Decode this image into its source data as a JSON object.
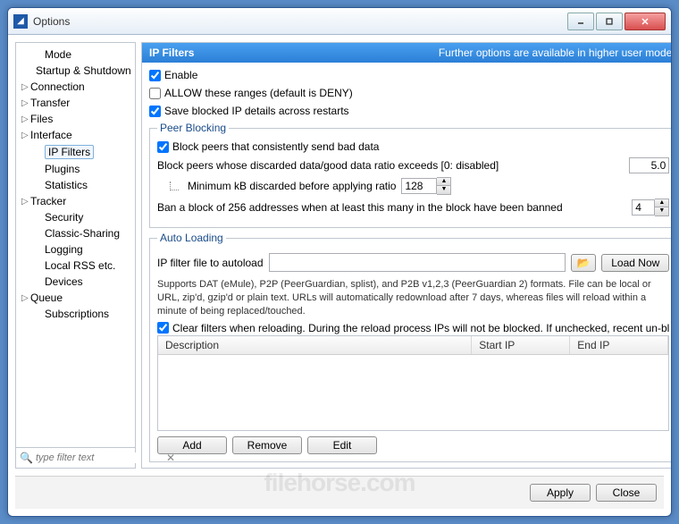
{
  "window": {
    "title": "Options"
  },
  "sidebar": {
    "items": [
      {
        "label": "Mode",
        "expandable": false,
        "indent": true
      },
      {
        "label": "Startup & Shutdown",
        "expandable": false,
        "indent": true
      },
      {
        "label": "Connection",
        "expandable": true
      },
      {
        "label": "Transfer",
        "expandable": true
      },
      {
        "label": "Files",
        "expandable": true
      },
      {
        "label": "Interface",
        "expandable": true
      },
      {
        "label": "IP Filters",
        "expandable": false,
        "indent": true,
        "selected": true
      },
      {
        "label": "Plugins",
        "expandable": false,
        "indent": true
      },
      {
        "label": "Statistics",
        "expandable": false,
        "indent": true
      },
      {
        "label": "Tracker",
        "expandable": true
      },
      {
        "label": "Security",
        "expandable": false,
        "indent": true
      },
      {
        "label": "Classic-Sharing",
        "expandable": false,
        "indent": true
      },
      {
        "label": "Logging",
        "expandable": false,
        "indent": true
      },
      {
        "label": "Local RSS etc.",
        "expandable": false,
        "indent": true
      },
      {
        "label": "Devices",
        "expandable": false,
        "indent": true
      },
      {
        "label": "Queue",
        "expandable": true
      },
      {
        "label": "Subscriptions",
        "expandable": false,
        "indent": true
      }
    ],
    "filter_placeholder": "type filter text"
  },
  "header": {
    "title": "IP Filters",
    "subtitle": "Further options are available in higher user modes"
  },
  "checks": {
    "enable": "Enable",
    "allow": "ALLOW these ranges (default is DENY)",
    "save_blocked": "Save blocked IP details across restarts"
  },
  "peer_blocking": {
    "legend": "Peer Blocking",
    "block_bad": "Block peers that consistently send bad data",
    "ratio_label": "Block peers whose discarded data/good data ratio exceeds [0: disabled]",
    "ratio_value": "5.0",
    "min_kb_label": "Minimum kB discarded before applying ratio",
    "min_kb_value": "128",
    "ban_block_label": "Ban a block of 256 addresses when at least this many in the block have been banned",
    "ban_block_value": "4"
  },
  "auto_loading": {
    "legend": "Auto Loading",
    "file_label": "IP filter file to autoload",
    "file_value": "",
    "load_now": "Load Now",
    "help": "Supports DAT (eMule), P2P (PeerGuardian, splist), and P2B v1,2,3 (PeerGuardian 2) formats.  File can be local or URL, zip'd, gzip'd or plain text.  URLs will automatically redownload after 7 days, whereas files will reload within a minute of being replaced/touched.",
    "clear_filters": "Clear filters when reloading. During the reload process IPs will not be blocked. If unchecked, recent un-bl"
  },
  "table": {
    "cols": {
      "desc": "Description",
      "start": "Start IP",
      "end": "End IP"
    }
  },
  "buttons": {
    "add": "Add",
    "remove": "Remove",
    "edit": "Edit",
    "apply": "Apply",
    "close": "Close"
  },
  "watermark": "filehorse.com"
}
